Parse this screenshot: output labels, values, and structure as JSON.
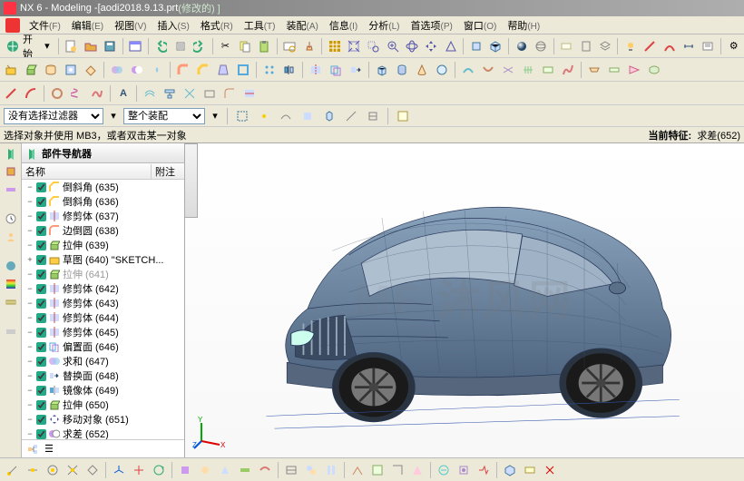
{
  "title_app": "NX 6 - Modeling - ",
  "title_file": "[aodi2018.9.13.prt ",
  "title_modified": "(修改的) ]",
  "menu": {
    "file": "文件",
    "edit": "编辑",
    "view": "视图",
    "insert": "插入",
    "format": "格式",
    "tools": "工具",
    "assemblies": "装配",
    "info": "信息",
    "analysis": "分析",
    "preferences": "首选项",
    "window": "窗口",
    "help": "帮助",
    "hot_f": "(F)",
    "hot_e": "(E)",
    "hot_v": "(V)",
    "hot_s": "(S)",
    "hot_r": "(R)",
    "hot_t": "(T)",
    "hot_a": "(A)",
    "hot_i": "(I)",
    "hot_l": "(L)",
    "hot_p": "(P)",
    "hot_o": "(O)",
    "hot_h": "(H)"
  },
  "start_label": "开始",
  "filter": {
    "sel": "没有选择过滤器",
    "assy": "整个装配"
  },
  "hint": {
    "left": "选择对象并使用 MB3，或者双击某一对象",
    "right_label": "当前特征:",
    "right_value": "求差(652)"
  },
  "nav": {
    "title": "部件导航器",
    "col_name": "名称",
    "col_note": "附注",
    "items": [
      {
        "label": "倒斜角 (635)",
        "icon": "chamfer",
        "dim": 0
      },
      {
        "label": "倒斜角 (636)",
        "icon": "chamfer",
        "dim": 0
      },
      {
        "label": "修剪体 (637)",
        "icon": "trim",
        "dim": 0
      },
      {
        "label": "边倒圆 (638)",
        "icon": "fillet",
        "dim": 0
      },
      {
        "label": "拉伸 (639)",
        "icon": "extrude",
        "dim": 0
      },
      {
        "label": "草图 (640) \"SKETCH...",
        "icon": "sketch",
        "dim": 0
      },
      {
        "label": "拉伸 (641)",
        "icon": "extrude",
        "dim": 1
      },
      {
        "label": "修剪体 (642)",
        "icon": "trim",
        "dim": 0
      },
      {
        "label": "修剪体 (643)",
        "icon": "trim",
        "dim": 0
      },
      {
        "label": "修剪体 (644)",
        "icon": "trim",
        "dim": 0
      },
      {
        "label": "修剪体 (645)",
        "icon": "trim",
        "dim": 0
      },
      {
        "label": "偏置面 (646)",
        "icon": "offset",
        "dim": 0
      },
      {
        "label": "求和 (647)",
        "icon": "unite",
        "dim": 0
      },
      {
        "label": "替换面 (648)",
        "icon": "replace",
        "dim": 0
      },
      {
        "label": "镜像体 (649)",
        "icon": "mirror",
        "dim": 0
      },
      {
        "label": "拉伸 (650)",
        "icon": "extrude",
        "dim": 0
      },
      {
        "label": "移动对象 (651)",
        "icon": "move",
        "dim": 0
      },
      {
        "label": "求差 (652)",
        "icon": "subtract",
        "dim": 0
      }
    ]
  },
  "watermark": "沐风网",
  "colors": {
    "car_body": "#5c7894",
    "car_edge": "#2a3a5a"
  },
  "icons": {
    "globe_edit": "#3a7",
    "new_doc": "#fc6",
    "open": "#e8b040",
    "save": "#6ab",
    "window": "#88f",
    "undo": "#3a7",
    "redo": "#3a7",
    "cut": "#f77",
    "copy": "#ff8",
    "paste": "#bd7",
    "grid": "#c90",
    "zoom_fit": "#88c",
    "zoom_in": "#88c",
    "zoom_out": "#88c",
    "zoom_rect": "#88c",
    "box3d": "#6b8",
    "sphere": "#9af",
    "block": "#5ad",
    "cone": "#c86",
    "extrude": "#9c6",
    "fillet": "#f97",
    "sketch_on": "#fc4",
    "curve": "#f99",
    "spline": "#d9f",
    "analyze": "#5cc",
    "point": "#fc0",
    "gear": "#aaa",
    "lamp": "#fc6",
    "sec": "#e9c"
  }
}
